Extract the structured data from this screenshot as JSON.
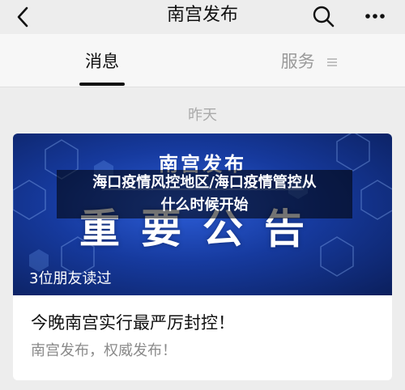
{
  "header": {
    "title": "南宫发布",
    "back_icon": "chevron-left-icon",
    "search_icon": "search-icon",
    "more_icon": "more-dots-icon"
  },
  "tabs": {
    "messages_label": "消息",
    "services_label": "服务"
  },
  "feed": {
    "date_label": "昨天",
    "card": {
      "banner_title": "南宫发布",
      "banner_big_text": "重要公告",
      "readers_text": "3位朋友读过",
      "article_title": "今晚南宫实行最严厉封控！",
      "article_subtitle": "南宫发布，权威发布！"
    }
  },
  "overlay": {
    "caption_line1": "海口疫情风控地区/海口疫情管控从",
    "caption_line2": "什么时候开始"
  },
  "colors": {
    "background": "#ededed",
    "banner_blue": "#163a9e",
    "text_primary": "#111111",
    "text_secondary": "#8a8a8a"
  }
}
